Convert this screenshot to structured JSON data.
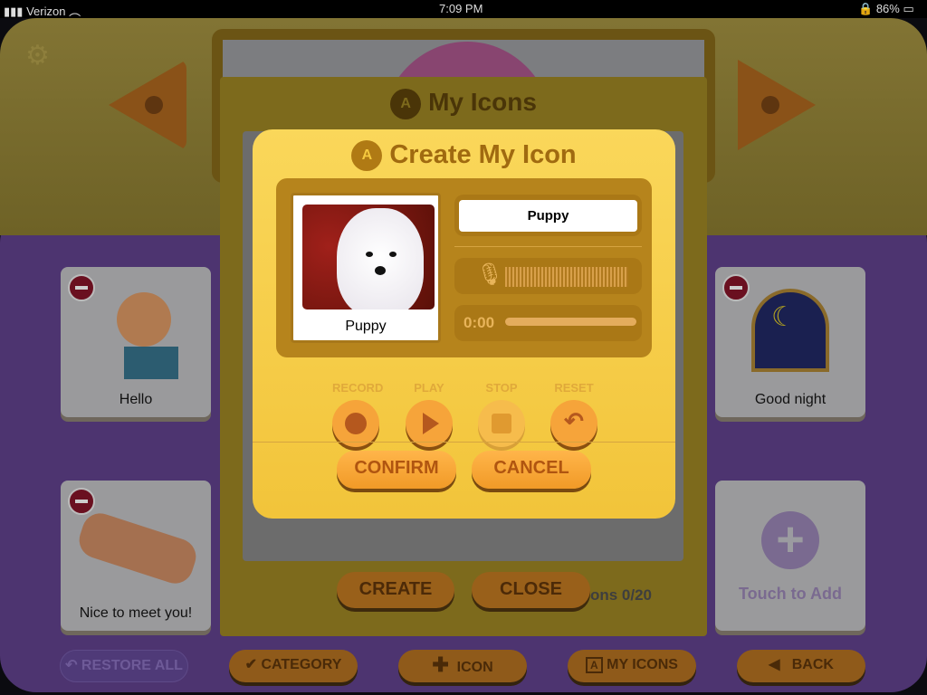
{
  "status_bar": {
    "carrier": "Verizon",
    "time": "7:09 PM",
    "battery": "86%"
  },
  "panel": {
    "title": "My Icons",
    "title_icon": "A",
    "custom_count": "Custom Icons 0/20",
    "create": "CREATE",
    "close": "CLOSE"
  },
  "cards": [
    {
      "label": "Hello"
    },
    {
      "label": "Good night"
    },
    {
      "label": "Nice to meet you!"
    },
    {
      "label": "Touch to Add"
    }
  ],
  "dialog": {
    "title": "Create My Icon",
    "title_icon": "A",
    "image_label": "Puppy",
    "name_value": "Puppy",
    "time": "0:00",
    "controls": [
      {
        "label": "RECORD",
        "icon": "record-icon"
      },
      {
        "label": "PLAY",
        "icon": "play-icon"
      },
      {
        "label": "STOP",
        "icon": "stop-icon"
      },
      {
        "label": "RESET",
        "icon": "reset-icon"
      }
    ],
    "confirm": "CONFIRM",
    "cancel": "CANCEL"
  },
  "bottom": {
    "restore": "RESTORE ALL",
    "category": "CATEGORY",
    "icon": "ICON",
    "my_icons": "MY ICONS",
    "my_icons_glyph": "A",
    "back": "BACK"
  },
  "colors": {
    "dialog": "#f5c93e",
    "button": "#f6a43a",
    "purple": "#4d3470"
  }
}
